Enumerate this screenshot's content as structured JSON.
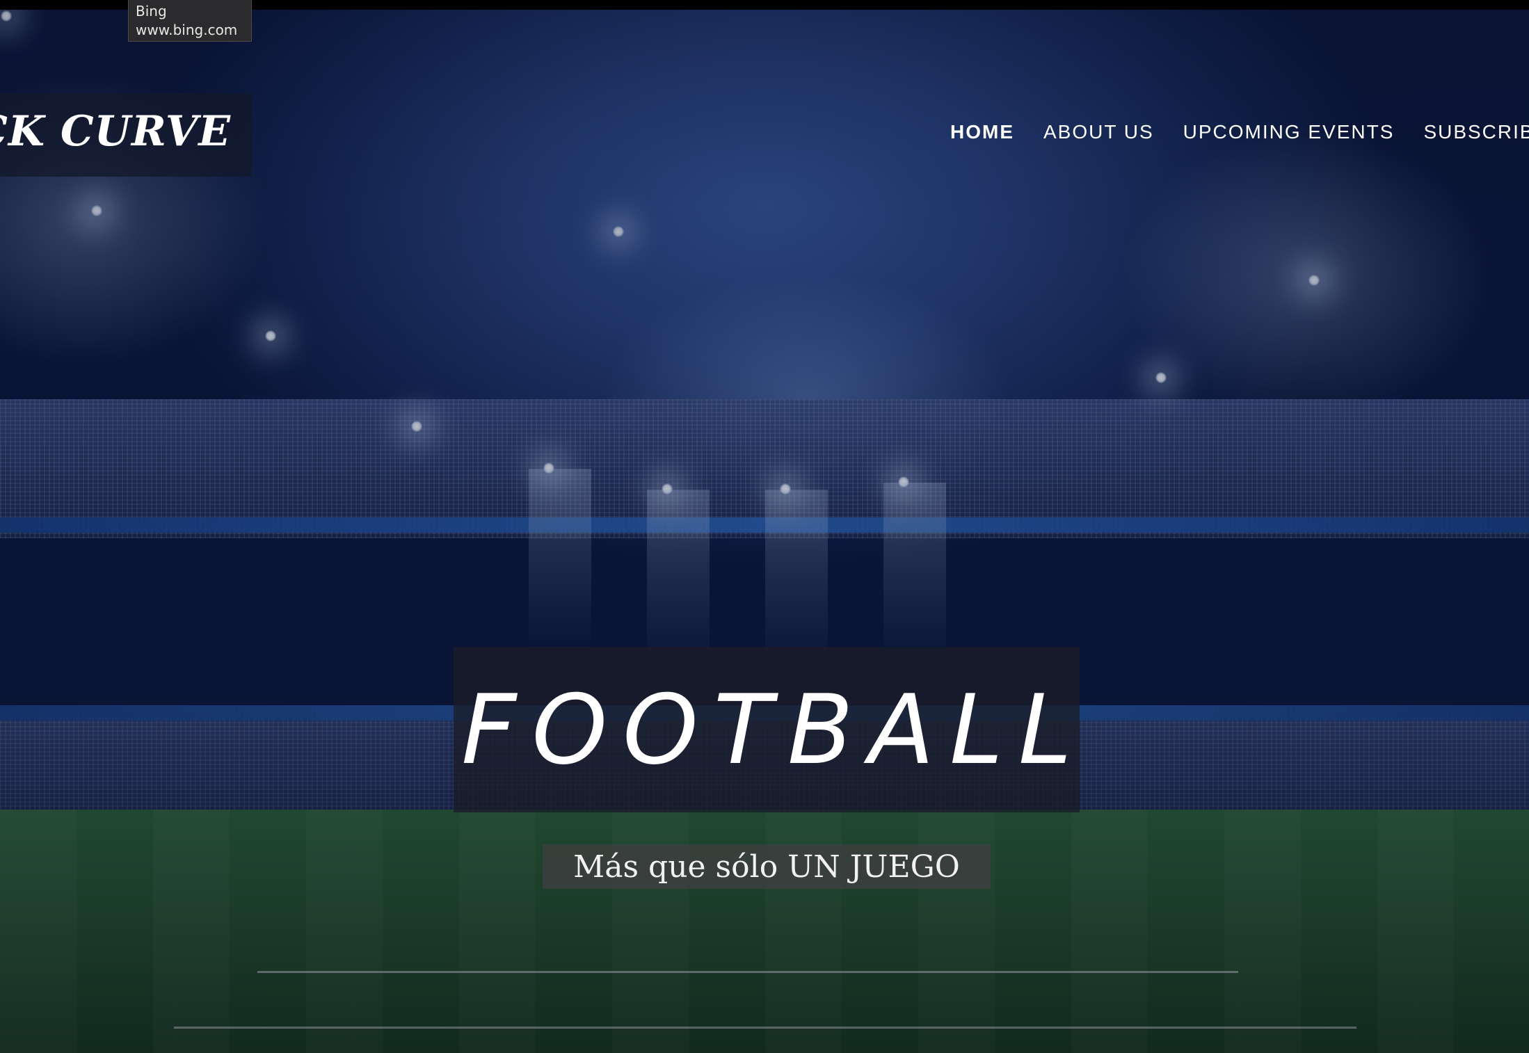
{
  "tooltip": {
    "title": "Bing",
    "url": "www.bing.com"
  },
  "header": {
    "logo_text": "ICK CURVE",
    "nav": [
      {
        "label": "HOME",
        "active": true
      },
      {
        "label": "ABOUT US",
        "active": false
      },
      {
        "label": "UPCOMING EVENTS",
        "active": false
      },
      {
        "label": "SUBSCRIBE U",
        "active": false
      }
    ]
  },
  "hero": {
    "title": "FOOTBALL",
    "tagline": "Más que sólo UN JUEGO"
  },
  "colors": {
    "background": "#0b1637",
    "overlay_box": "#191c28",
    "tagline_box": "#3c3e3e",
    "text": "#ffffff"
  }
}
